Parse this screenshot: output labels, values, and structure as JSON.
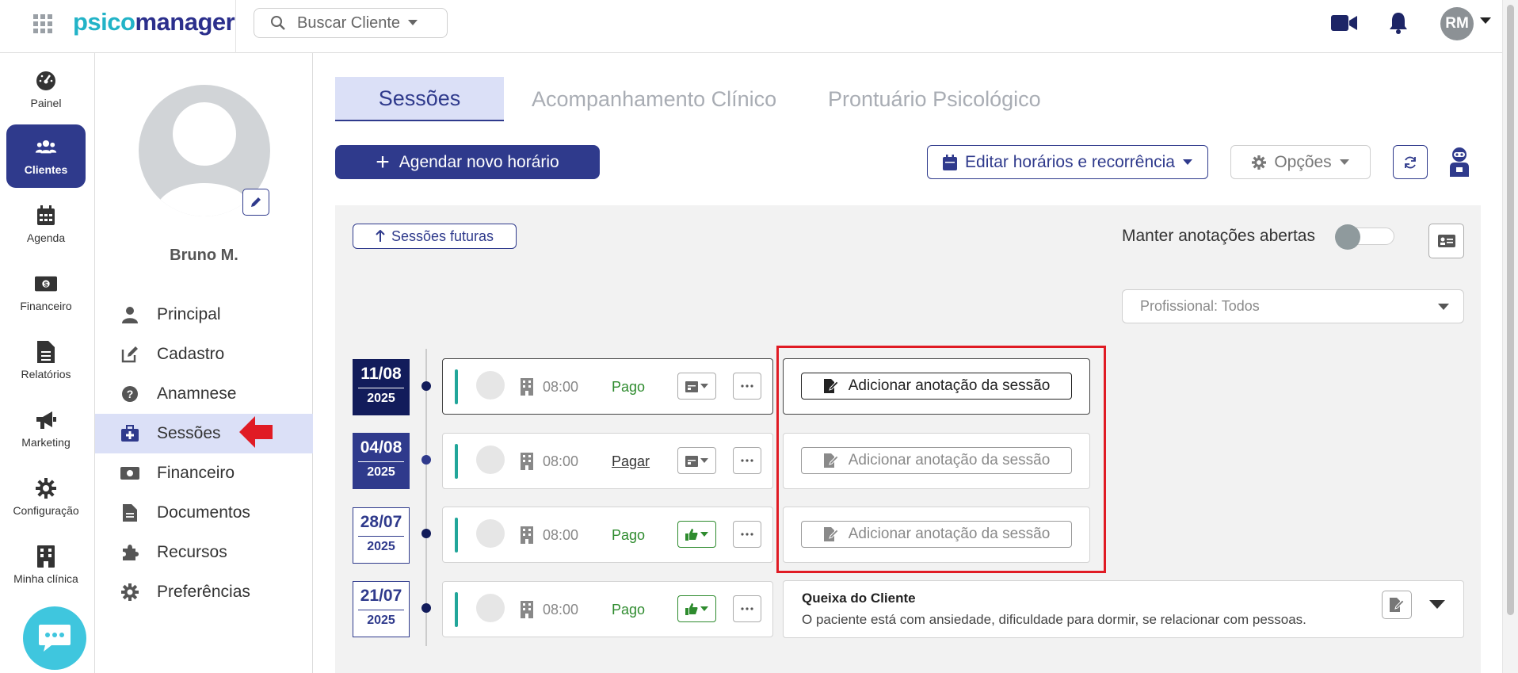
{
  "app": {
    "logo_part1": "psico",
    "logo_part2": "manager"
  },
  "topbar": {
    "search_placeholder": "Buscar Cliente",
    "avatar_initials": "RM"
  },
  "rail": {
    "items": [
      {
        "label": "Painel",
        "icon": "gauge-icon"
      },
      {
        "label": "Clientes",
        "icon": "users-icon",
        "active": true
      },
      {
        "label": "Agenda",
        "icon": "calendar-icon"
      },
      {
        "label": "Financeiro",
        "icon": "money-icon"
      },
      {
        "label": "Relatórios",
        "icon": "document-icon"
      },
      {
        "label": "Marketing",
        "icon": "megaphone-icon"
      },
      {
        "label": "Configuração",
        "icon": "gear-icon"
      },
      {
        "label": "Minha clínica",
        "icon": "building-icon"
      }
    ]
  },
  "client": {
    "name": "Bruno M."
  },
  "menu": {
    "items": [
      {
        "label": "Principal",
        "icon": "user-icon"
      },
      {
        "label": "Cadastro",
        "icon": "edit-icon"
      },
      {
        "label": "Anamnese",
        "icon": "question-icon"
      },
      {
        "label": "Sessões",
        "icon": "briefcase-medical-icon",
        "active": true
      },
      {
        "label": "Financeiro",
        "icon": "money-icon"
      },
      {
        "label": "Documentos",
        "icon": "document-icon"
      },
      {
        "label": "Recursos",
        "icon": "puzzle-icon"
      },
      {
        "label": "Preferências",
        "icon": "gear-icon"
      }
    ]
  },
  "tabs": [
    {
      "label": "Sessões",
      "active": true
    },
    {
      "label": "Acompanhamento Clínico"
    },
    {
      "label": "Prontuário Psicológico"
    }
  ],
  "toolbar": {
    "new_schedule": "Agendar novo horário",
    "edit_schedule": "Editar horários e recorrência",
    "options": "Opções"
  },
  "panel": {
    "future_sessions": "Sessões futuras",
    "keep_notes_open": "Manter anotações abertas",
    "professional_filter": "Profissional: Todos"
  },
  "sessions": [
    {
      "day": "11/08",
      "year": "2025",
      "time": "08:00",
      "payment": "Pago",
      "note_label": "Adicionar anotação da sessão"
    },
    {
      "day": "04/08",
      "year": "2025",
      "time": "08:00",
      "payment": "Pagar",
      "note_label": "Adicionar anotação da sessão"
    },
    {
      "day": "28/07",
      "year": "2025",
      "time": "08:00",
      "payment": "Pago",
      "note_label": "Adicionar anotação da sessão"
    },
    {
      "day": "21/07",
      "year": "2025",
      "time": "08:00",
      "payment": "Pago"
    }
  ],
  "complaint": {
    "title": "Queixa do Cliente",
    "text": "O paciente está com ansiedade, dificuldade para dormir, se relacionar com pessoas."
  },
  "colors": {
    "primary": "#2f3a8c",
    "dark_navy": "#121c5b",
    "accent_teal": "#22b3c7",
    "paid_green": "#2e8b2e",
    "highlight_red": "#e01b24"
  }
}
